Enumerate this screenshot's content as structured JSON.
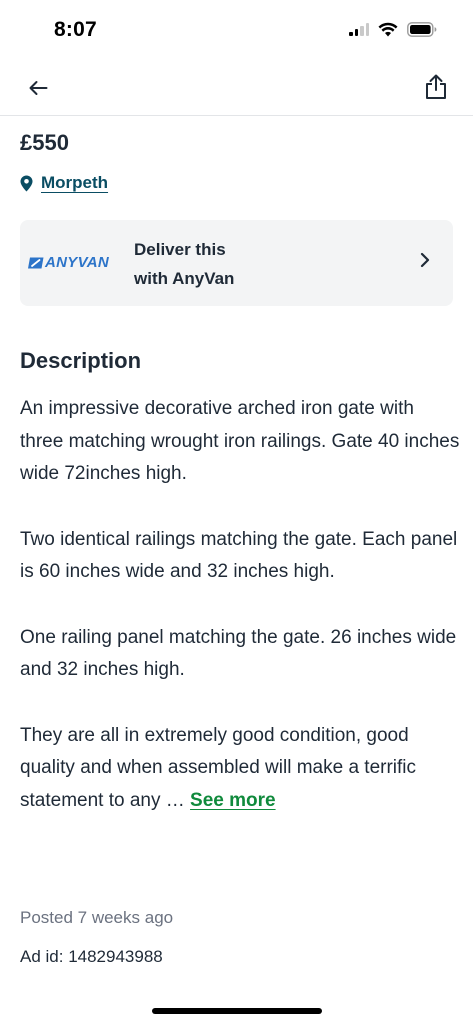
{
  "status_bar": {
    "time": "8:07"
  },
  "nav": {
    "back_icon": "arrow-left-icon",
    "share_icon": "share-icon"
  },
  "listing": {
    "price": "£550",
    "location": "Morpeth"
  },
  "anyvan": {
    "logo_text": "ANYVAN",
    "line1": "Deliver this",
    "line2": "with AnyVan",
    "brand_color": "#2c74c9"
  },
  "description": {
    "heading": "Description",
    "paragraphs": [
      "An impressive decorative arched iron gate with three matching wrought iron railings. Gate 40 inches wide 72inches high.",
      "Two identical railings matching the gate. Each panel is 60 inches wide and 32 inches high.",
      "One railing panel matching the gate. 26 inches wide and 32 inches high.",
      "They are all in extremely good condition, good quality and when assembled will make a terrific statement to any …"
    ],
    "see_more": "See more"
  },
  "meta": {
    "posted": "Posted 7 weeks ago",
    "ad_id": "Ad id: 1482943988"
  },
  "colors": {
    "text": "#1f2a37",
    "location_link": "#0a4d63",
    "see_more": "#108a3c",
    "card_bg": "#f3f4f5"
  }
}
